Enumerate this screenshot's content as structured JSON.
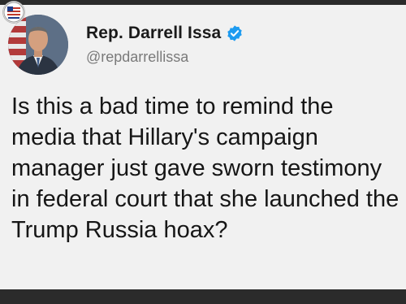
{
  "tweet": {
    "author": {
      "display_name": "Rep. Darrell Issa",
      "handle": "@repdarrellissa",
      "verified": true
    },
    "text": "Is this a bad time to remind the media that Hillary's campaign manager just gave sworn testimony in federal court that she launched the Trump Russia hoax?"
  },
  "colors": {
    "card_background": "#f1f1f1",
    "frame": "#2b2b2b",
    "verified_badge": "#1d9bf0",
    "text": "#161616",
    "handle": "#7a7a7a"
  },
  "icons": {
    "watermark": "flag-logo-icon",
    "verified": "verified-badge-icon"
  }
}
